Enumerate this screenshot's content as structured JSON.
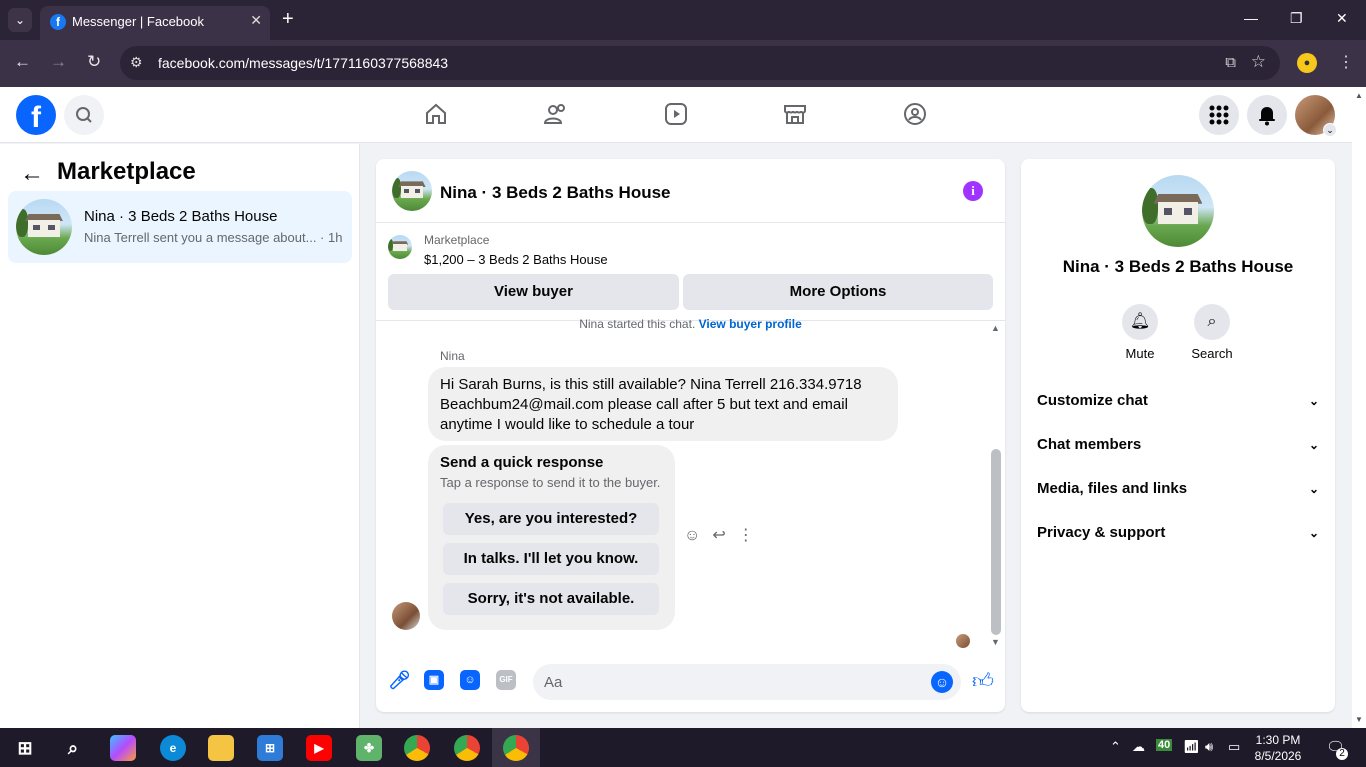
{
  "browser": {
    "tab_title": "Messenger | Facebook",
    "url": "facebook.com/messages/t/1771160377568843",
    "tab_menu_icon": "chevron-down-icon",
    "new_tab_label": "+"
  },
  "header": {
    "logo_letter": "f"
  },
  "left_panel": {
    "back_arrow": "←",
    "title": "Marketplace",
    "conversations": [
      {
        "name": "Nina · 3 Beds 2 Baths House",
        "preview": "Nina Terrell sent you a message about... · 1h"
      }
    ]
  },
  "chat": {
    "title": "Nina · 3 Beds 2 Baths House",
    "marketplace_label": "Marketplace",
    "listing": "$1,200 – 3 Beds 2 Baths House",
    "view_buyer": "View buyer",
    "more_options": "More Options",
    "started_text": "Nina started this chat.",
    "view_buyer_profile": "View buyer profile",
    "sender": "Nina",
    "message": "Hi Sarah Burns, is this still available? Nina Terrell 216.334.9718 Beachbum24@mail.com please call after 5 but text and email anytime I would like to schedule a tour",
    "quick_response": {
      "heading": "Send a quick response",
      "subtitle": "Tap a response to send it to the buyer.",
      "options": [
        "Yes, are you interested?",
        "In talks. I'll let you know.",
        "Sorry, it's not available."
      ]
    },
    "composer_placeholder": "Aa",
    "gif_label": "GIF"
  },
  "right_panel": {
    "name": "Nina · 3 Beds 2 Baths House",
    "mute_label": "Mute",
    "search_label": "Search",
    "sections": [
      "Customize chat",
      "Chat members",
      "Media, files and links",
      "Privacy & support"
    ]
  },
  "taskbar": {
    "time": "1:30 PM",
    "date": "8/5/2026",
    "badge": "40",
    "notification_count": "2"
  },
  "colors": {
    "brand": "#0866ff",
    "info": "#a033ff",
    "link": "#0064d1"
  }
}
